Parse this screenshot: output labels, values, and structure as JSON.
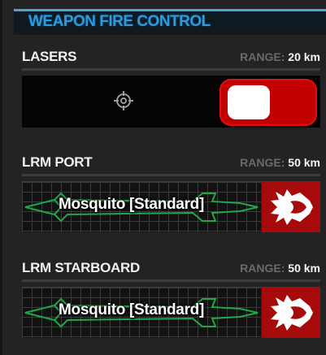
{
  "panel": {
    "title": "WEAPON FIRE CONTROL"
  },
  "colors": {
    "title": "#2b9be0",
    "toggle_on": "#c30000",
    "fire_button": "#a60a0a",
    "missile_outline": "#1fa84a",
    "range_label": "#6a6a6a"
  },
  "weapons": [
    {
      "name": "LASERS",
      "range_label": "RANGE:",
      "range_value": "20 km",
      "icon": "crosshair-icon",
      "toggle_state": "on"
    },
    {
      "name": "LRM PORT",
      "range_label": "RANGE:",
      "range_value": "50 km",
      "missile": "Mosquito [Standard]",
      "icon": "fire-burst-icon"
    },
    {
      "name": "LRM STARBOARD",
      "range_label": "RANGE:",
      "range_value": "50 km",
      "missile": "Mosquito [Standard]",
      "icon": "fire-burst-icon"
    }
  ]
}
